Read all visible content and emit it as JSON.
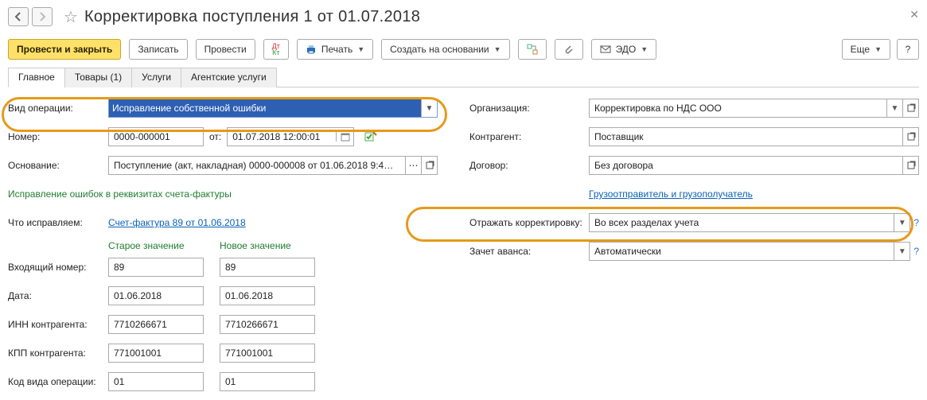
{
  "title": "Корректировка поступления 1 от 01.07.2018",
  "toolbar": {
    "main": "Провести и закрыть",
    "write": "Записать",
    "post": "Провести",
    "print": "Печать",
    "create_basis": "Создать на основании",
    "edo": "ЭДО",
    "more": "Еще",
    "help": "?"
  },
  "tabs": [
    "Главное",
    "Товары (1)",
    "Услуги",
    "Агентские услуги"
  ],
  "left": {
    "operation_label": "Вид операции:",
    "operation_value": "Исправление собственной ошибки",
    "number_label": "Номер:",
    "number_value": "0000-000001",
    "from_label": "от:",
    "date_value": "01.07.2018 12:00:01",
    "basis_label": "Основание:",
    "basis_value": "Поступление (акт, накладная) 0000-000008 от 01.06.2018 9:4…",
    "rekv_text": "Исправление ошибок в реквизитах счета-фактуры",
    "fix_label": "Что исправляем:",
    "fix_link": "Счет-фактура 89 от 01.06.2018",
    "old_header": "Старое значение",
    "new_header": "Новое значение",
    "in_num_label": "Входящий номер:",
    "in_num_old": "89",
    "in_num_new": "89",
    "date_label": "Дата:",
    "date_old": "01.06.2018",
    "date_new": "01.06.2018",
    "inn_label": "ИНН контрагента:",
    "inn_old": "7710266671",
    "inn_new": "7710266671",
    "kpp_label": "КПП контрагента:",
    "kpp_old": "771001001",
    "kpp_new": "771001001",
    "kod_label": "Код вида операции:",
    "kod_old": "01",
    "kod_new": "01"
  },
  "right": {
    "org_label": "Организация:",
    "org_value": "Корректировка по НДС ООО",
    "contra_label": "Контрагент:",
    "contra_value": "Поставщик",
    "contract_label": "Договор:",
    "contract_value": "Без договора",
    "gruzo_link": "Грузоотправитель и грузополучатель",
    "reflect_label": "Отражать корректировку:",
    "reflect_value": "Во всех разделах учета",
    "advance_label": "Зачет аванса:",
    "advance_value": "Автоматически",
    "help": "?"
  }
}
